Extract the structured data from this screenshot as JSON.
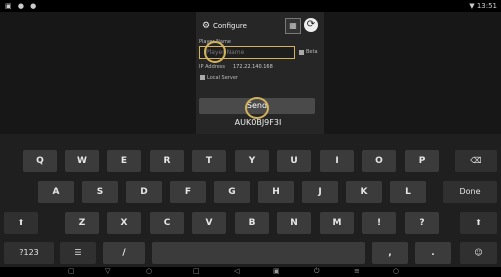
{
  "status": {
    "left": "▣ ● ●",
    "right": "▼ 13:51"
  },
  "panel": {
    "title": "Configure",
    "player_name_label": "Player Name",
    "player_name_placeholder": "Player Name",
    "beta_label": "Beta",
    "ip_label": "IP Address",
    "ip_value": "172.22.140.168",
    "local_server_label": "Local Server",
    "send_label": "Send",
    "code": "AUK0BJ9F3I"
  },
  "keyboard": {
    "row1": [
      "Q",
      "W",
      "E",
      "R",
      "T",
      "Y",
      "U",
      "I",
      "O",
      "P"
    ],
    "backspace": "⌫",
    "row2": [
      "A",
      "S",
      "D",
      "F",
      "G",
      "H",
      "J",
      "K",
      "L"
    ],
    "done": "Done",
    "row3": [
      "Z",
      "X",
      "C",
      "V",
      "B",
      "N",
      "M",
      "!",
      "?"
    ],
    "shift": "⬆",
    "sym": "?123",
    "mic": "☰",
    "slash": "/",
    "comma": ",",
    "period": ".",
    "emoji": "☺"
  },
  "navbar": [
    "▢",
    "▽",
    "○",
    "□",
    "◁",
    "▣",
    "⏻",
    "≡",
    "○"
  ],
  "colors": {
    "accent": "#d4b35a",
    "key": "#3b3b3b",
    "keyboard_bg": "#1f1f1f"
  }
}
